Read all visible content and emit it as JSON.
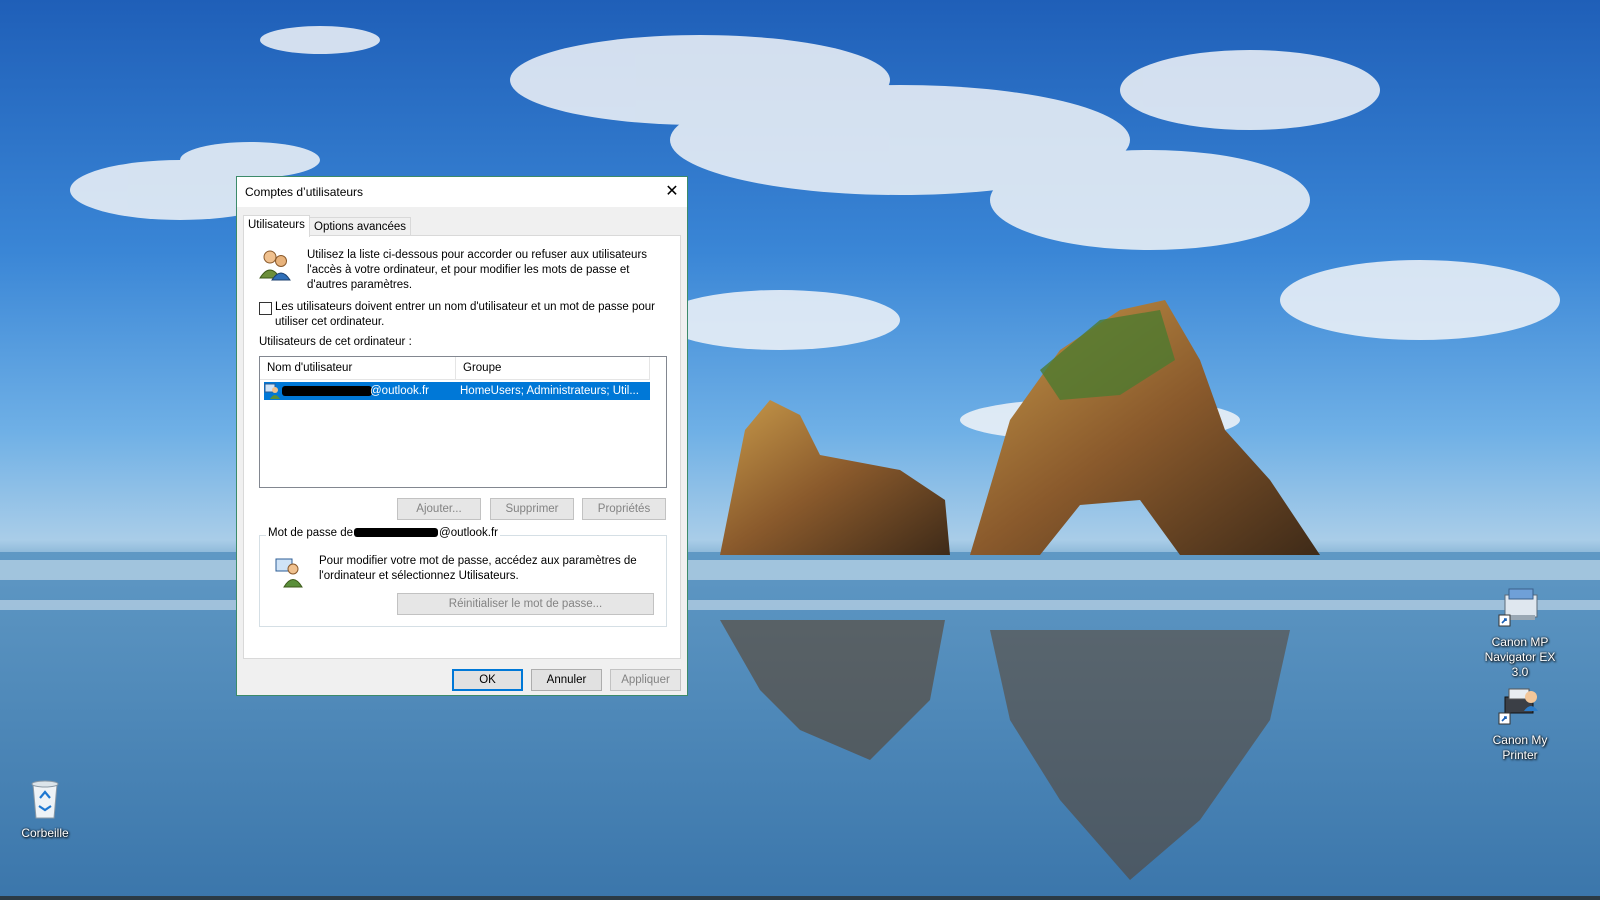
{
  "dialog": {
    "title": "Comptes d’utilisateurs",
    "close_glyph": "✕",
    "tabs": [
      {
        "label": "Utilisateurs",
        "active": true
      },
      {
        "label": "Options avancées",
        "active": false
      }
    ],
    "intro_text": "Utilisez la liste ci-dessous pour accorder ou refuser aux utilisateurs l'accès à votre ordinateur, et pour modifier les mots de passe et d'autres paramètres.",
    "require_login": {
      "label": "Les utilisateurs doivent entrer un nom d'utilisateur et un mot de passe pour utiliser cet ordinateur.",
      "checked": false
    },
    "users_label": "Utilisateurs de cet ordinateur :",
    "columns": [
      "Nom d'utilisateur",
      "Groupe"
    ],
    "rows": [
      {
        "username": "@outlook.fr",
        "group": "HomeUsers; Administrateurs; Util...",
        "selected": true
      }
    ],
    "list_buttons": {
      "add": "Ajouter...",
      "remove": "Supprimer",
      "properties": "Propriétés"
    },
    "password_group": {
      "legend_prefix": "Mot de passe de",
      "legend_suffix": "@outlook.fr",
      "text": "Pour modifier votre mot de passe, accédez aux paramètres de l'ordinateur et sélectionnez Utilisateurs.",
      "reset_button": "Réinitialiser le mot de passe..."
    },
    "footer_buttons": {
      "ok": "OK",
      "cancel": "Annuler",
      "apply": "Appliquer"
    },
    "accent_color": "#0078d7"
  },
  "desktop": {
    "icons": [
      {
        "label": "Corbeille",
        "icon": "recycle-bin-icon"
      },
      {
        "label": "Canon MP Navigator EX 3.0",
        "icon": "scanner-shortcut-icon"
      },
      {
        "label": "Canon My Printer",
        "icon": "printer-shortcut-icon"
      }
    ]
  }
}
